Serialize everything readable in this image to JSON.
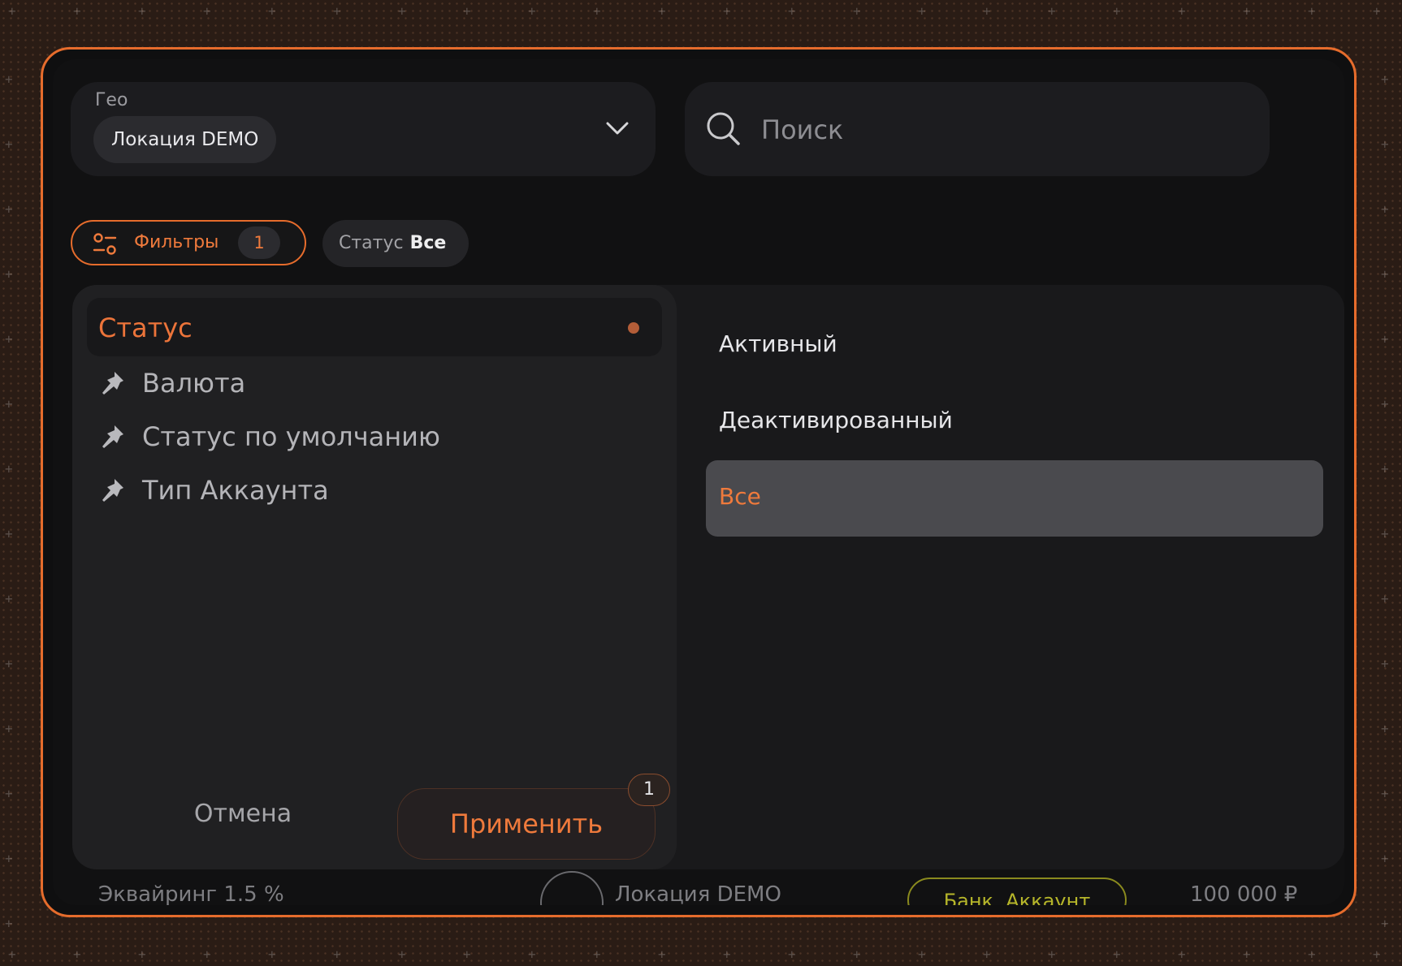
{
  "geo": {
    "label": "Гео",
    "selected": "Локация DEMO"
  },
  "search": {
    "placeholder": "Поиск"
  },
  "filters": {
    "label": "Фильтры",
    "count": "1"
  },
  "status_chip": {
    "key": "Статус",
    "value": "Все"
  },
  "categories": [
    {
      "label": "Статус",
      "active": true
    },
    {
      "label": "Валюта",
      "active": false
    },
    {
      "label": "Статус по умолчанию",
      "active": false
    },
    {
      "label": "Тип Аккаунта",
      "active": false
    }
  ],
  "options": [
    {
      "label": "Активный",
      "selected": false
    },
    {
      "label": "Деактивированный",
      "selected": false
    },
    {
      "label": "Все",
      "selected": true
    }
  ],
  "actions": {
    "cancel": "Отмена",
    "apply": "Применить",
    "apply_badge": "1"
  },
  "background_row": {
    "acquiring": "Эквайринг 1.5 %",
    "location": "Локация DEMO",
    "badge": "Банк. Аккаунт",
    "amount": "100 000 ₽"
  },
  "colors": {
    "accent": "#e66c2c",
    "panel": "#202022",
    "selected_option": "#4a4a4e"
  }
}
